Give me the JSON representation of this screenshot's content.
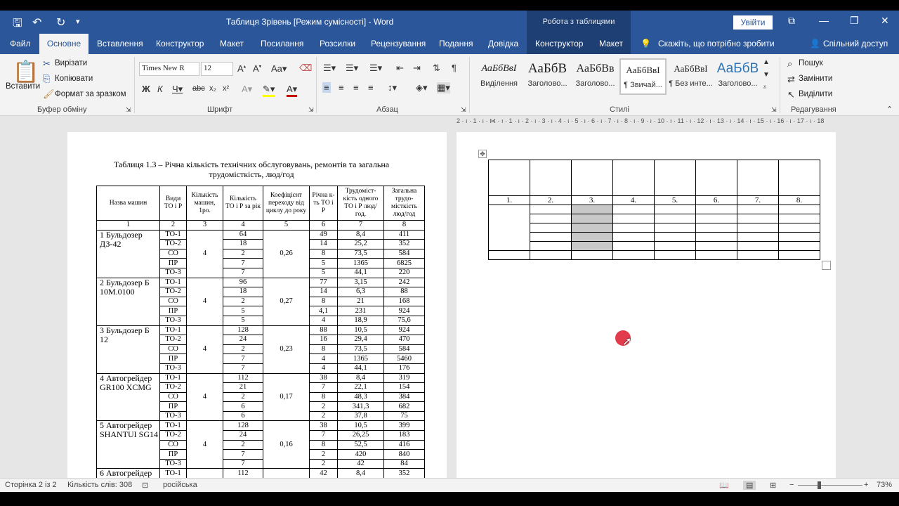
{
  "app": {
    "doc_title": "Таблиця Зрівень [Режим сумісності]  -  Word",
    "context_title": "Робота з таблицями",
    "signin": "Увійти"
  },
  "tabs": {
    "file": "Файл",
    "home": "Основне",
    "insert": "Вставлення",
    "design": "Конструктор",
    "layout": "Макет",
    "references": "Посилання",
    "mailings": "Розсилки",
    "review": "Рецензування",
    "view": "Подання",
    "help": "Довідка",
    "table_design": "Конструктор",
    "table_layout": "Макет",
    "tell_me": "Скажіть, що потрібно зробити",
    "share": "Спільний доступ"
  },
  "ribbon": {
    "paste": "Вставити",
    "cut": "Вирізати",
    "copy": "Копіювати",
    "format_painter": "Формат за зразком",
    "clipboard_group": "Буфер обміну",
    "font_name": "Times New R",
    "font_size": "12",
    "font_group": "Шрифт",
    "paragraph_group": "Абзац",
    "styles_group": "Стилі",
    "editing_group": "Редагування",
    "find": "Пошук",
    "replace": "Замінити",
    "select": "Виділити",
    "styles": [
      {
        "sample": "АаБбВвІ",
        "name": "Виділення"
      },
      {
        "sample": "АаБбВ",
        "name": "Заголово..."
      },
      {
        "sample": "АаБбВв",
        "name": "Заголово..."
      },
      {
        "sample": "АаБбВвІ",
        "name": "¶ Звичай..."
      },
      {
        "sample": "АаБбВвІ",
        "name": "¶ Без инте..."
      },
      {
        "sample": "АаБбВ",
        "name": "Заголово..."
      }
    ]
  },
  "ruler_text": "2 · ı · 1 · ı · ⋈ · ı · 1 · ı · 2 · ı · 3 · ı · 4 · ı · 5 · ı · 6 · ı · 7 · ı · 8 · ı · 9 · ı · 10 · ı · 11 · ı · 12 · ı · 13 · ı · 14 · ı · 15 · ı · 16 · ı · 17 · ı · 18",
  "document": {
    "caption_line1": "Таблиця 1.3 – Річна кількість технічних обслуговувань, ремонтів та загальна",
    "caption_line2": "трудомісткість, люд/год",
    "headers": [
      "Назва машин",
      "Види ТО і Р",
      "Кількість машин, 1ро.",
      "Кількість ТО і Р за рік",
      "Коефіцієнт переходу від циклу до року",
      "Річна к-ть ТО і Р",
      "Трудоміст-кість одного ТО і Р люд/год.",
      "Загальна трудо-місткість люд/год"
    ],
    "numbers": [
      "1",
      "2",
      "3",
      "4",
      "5",
      "6",
      "7",
      "8"
    ],
    "machines": [
      {
        "name": "1 Бульдозер ДЗ-42",
        "count": "4",
        "coef": "0,26",
        "rows": [
          [
            "ТО-1",
            "64",
            "49",
            "8,4",
            "411"
          ],
          [
            "ТО-2",
            "18",
            "14",
            "25,2",
            "352"
          ],
          [
            "СО",
            "2",
            "8",
            "73,5",
            "584"
          ],
          [
            "ПР",
            "7",
            "5",
            "1365",
            "6825"
          ],
          [
            "ТО-3",
            "7",
            "5",
            "44,1",
            "220"
          ]
        ]
      },
      {
        "name": "2 Бульдозер  Б 10М.0100",
        "count": "4",
        "coef": "0,27",
        "rows": [
          [
            "ТО-1",
            "96",
            "77",
            "3,15",
            "242"
          ],
          [
            "ТО-2",
            "18",
            "14",
            "6,3",
            "88"
          ],
          [
            "СО",
            "2",
            "8",
            "21",
            "168"
          ],
          [
            "ПР",
            "5",
            "4,1",
            "231",
            "924"
          ],
          [
            "ТО-3",
            "5",
            "4",
            "18,9",
            "75,6"
          ]
        ]
      },
      {
        "name": "3 Бульдозер Б 12",
        "count": "4",
        "coef": "0,23",
        "rows": [
          [
            "ТО-1",
            "128",
            "88",
            "10,5",
            "924"
          ],
          [
            "ТО-2",
            "24",
            "16",
            "29,4",
            "470"
          ],
          [
            "СО",
            "2",
            "8",
            "73,5",
            "584"
          ],
          [
            "ПР",
            "7",
            "4",
            "1365",
            "5460"
          ],
          [
            "ТО-3",
            "7",
            "4",
            "44,1",
            "176"
          ]
        ]
      },
      {
        "name": "4 Автогрейдер GR100 XCMG",
        "count": "4",
        "coef": "0,17",
        "rows": [
          [
            "ТО-1",
            "112",
            "38",
            "8,4",
            "319"
          ],
          [
            "ТО-2",
            "21",
            "7",
            "22,1",
            "154"
          ],
          [
            "СО",
            "2",
            "8",
            "48,3",
            "384"
          ],
          [
            "ПР",
            "6",
            "2",
            "341,3",
            "682"
          ],
          [
            "ТО-3",
            "6",
            "2",
            "37,8",
            "75"
          ]
        ]
      },
      {
        "name": "5 Автогрейдер SHANTUI SG14",
        "count": "4",
        "coef": "0,16",
        "rows": [
          [
            "ТО-1",
            "128",
            "38",
            "10,5",
            "399"
          ],
          [
            "ТО-2",
            "24",
            "7",
            "26,25",
            "183"
          ],
          [
            "СО",
            "2",
            "8",
            "52,5",
            "416"
          ],
          [
            "ПР",
            "7",
            "2",
            "420",
            "840"
          ],
          [
            "ТО-3",
            "7",
            "2",
            "42",
            "84"
          ]
        ]
      },
      {
        "name": "6 Автогрейдер",
        "count": "",
        "coef": "",
        "rows": [
          [
            "ТО-1",
            "112",
            "42",
            "8,4",
            "352"
          ]
        ]
      }
    ],
    "template_numbers": [
      "1.",
      "2.",
      "3.",
      "4.",
      "5.",
      "6.",
      "7.",
      "8."
    ]
  },
  "status": {
    "page": "Сторінка 2 із 2",
    "words": "Кількість слів: 308",
    "language": "російська",
    "zoom": "73%"
  }
}
